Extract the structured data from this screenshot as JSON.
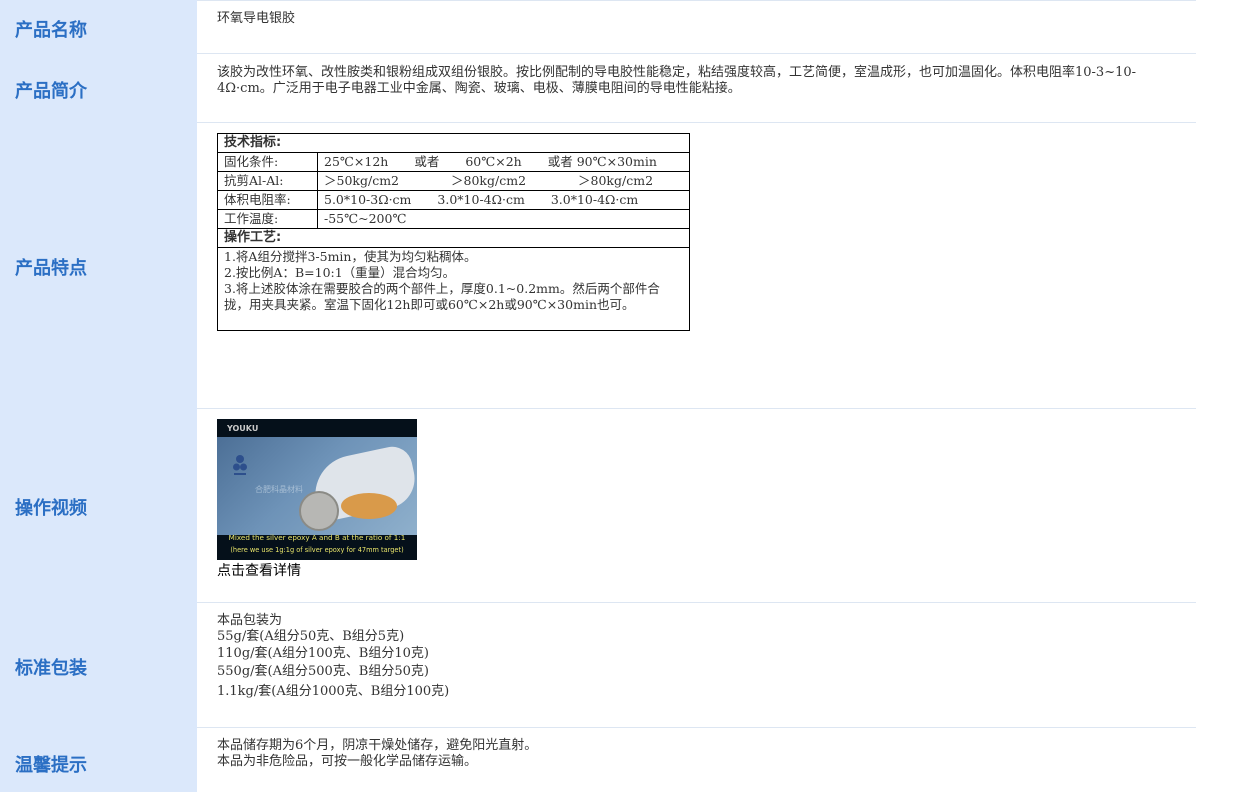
{
  "labels": {
    "name": "产品名称",
    "intro": "产品简介",
    "features": "产品特点",
    "video": "操作视频",
    "package": "标准包装",
    "tips": "温馨提示"
  },
  "product_name": "环氧导电银胶",
  "intro": "该胶为改性环氧、改性胺类和银粉组成双组份银胶。按比例配制的导电胶性能稳定，粘结强度较高，工艺简便，室温成形，也可加温固化。体积电阻率10-3~10-4Ω·cm。广泛用于电子电器工业中金属、陶瓷、玻璃、电极、薄膜电阻间的导电性能粘接。",
  "spec": {
    "tech_header": "技术指标:",
    "rows": [
      {
        "key": "固化条件:",
        "v1": "25℃×12h",
        "or1": "或者",
        "v2": "60℃×2h",
        "or2": "或者",
        "v3": "90℃×30min"
      },
      {
        "key": "抗剪Al-Al:",
        "v1": "＞50kg/cm2",
        "v2": "＞80kg/cm2",
        "v3": "＞80kg/cm2"
      },
      {
        "key": "体积电阻率:",
        "v1": "5.0*10-3Ω·cm",
        "v2": "3.0*10-4Ω·cm",
        "v3": "3.0*10-4Ω·cm"
      },
      {
        "key": "工作温度:",
        "v1": "-55℃~200℃"
      }
    ],
    "process_header": "操作工艺:",
    "steps": [
      "1.将A组分搅拌3-5min，使其为均匀粘稠体。",
      "2.按比例A：B=10:1（重量）混合均匀。",
      "3.将上述胶体涂在需要胶合的两个部件上，厚度0.1~0.2mm。然后两个部件合拢，用夹具夹紧。室温下固化12h即可或60℃×2h或90℃×30min也可。"
    ]
  },
  "video": {
    "brand": "YOUKU",
    "watermark": "合肥科晶材料",
    "caption1": "Mixed the silver epoxy A and B at the ratio of 1:1",
    "caption2": "(here we use 1g:1g of silver epoxy for 47mm target)",
    "link": "点击查看详情"
  },
  "package": [
    "本品包装为",
    "55g/套(A组分50克、B组分5克)",
    "110g/套(A组分100克、B组分10克)",
    "550g/套(A组分500克、B组分50克)",
    "1.1kg/套(A组分1000克、B组分100克)"
  ],
  "tips": [
    "本品储存期为6个月，阴凉干燥处储存，避免阳光直射。",
    "本品为非危险品，可按一般化学品储存运输。"
  ],
  "colors": {
    "label": "#2b6fc4",
    "sidebar": "#dbe8fb"
  }
}
